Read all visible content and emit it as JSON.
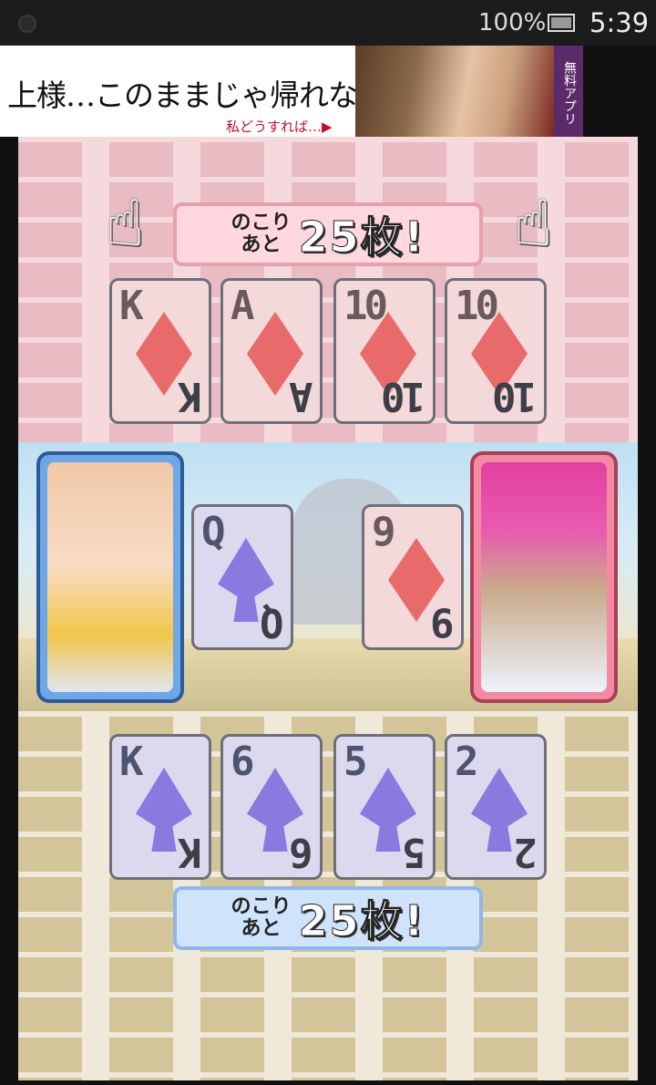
{
  "status_bar": {
    "battery": "100%",
    "time": "5:39"
  },
  "ad": {
    "headline": "上様…このままじゃ帰れない",
    "subline": "私どうすれば…▶",
    "tag": "無料アプリ"
  },
  "game": {
    "opponent": {
      "remaining_prefix": "のこり\nあと",
      "remaining_count": "25枚!",
      "hand": [
        {
          "rank": "K",
          "suit": "diamond"
        },
        {
          "rank": "A",
          "suit": "diamond"
        },
        {
          "rank": "10",
          "suit": "diamond"
        },
        {
          "rank": "10",
          "suit": "diamond"
        }
      ]
    },
    "field": [
      {
        "rank": "Q",
        "suit": "spade"
      },
      {
        "rank": "9",
        "suit": "diamond"
      }
    ],
    "player": {
      "remaining_prefix": "のこり\nあと",
      "remaining_count": "25枚!",
      "hand": [
        {
          "rank": "K",
          "suit": "spade"
        },
        {
          "rank": "6",
          "suit": "spade"
        },
        {
          "rank": "5",
          "suit": "spade"
        },
        {
          "rank": "2",
          "suit": "spade"
        }
      ]
    },
    "colors": {
      "diamond": "#e86a6a",
      "spade": "#8c79df",
      "opponent_frame": "#f18aa2",
      "player_frame": "#6fa7e6"
    }
  },
  "icons": {
    "pointer": "pointing-hand-icon",
    "diamond": "diamond-suit-icon",
    "spade": "spade-suit-icon"
  }
}
